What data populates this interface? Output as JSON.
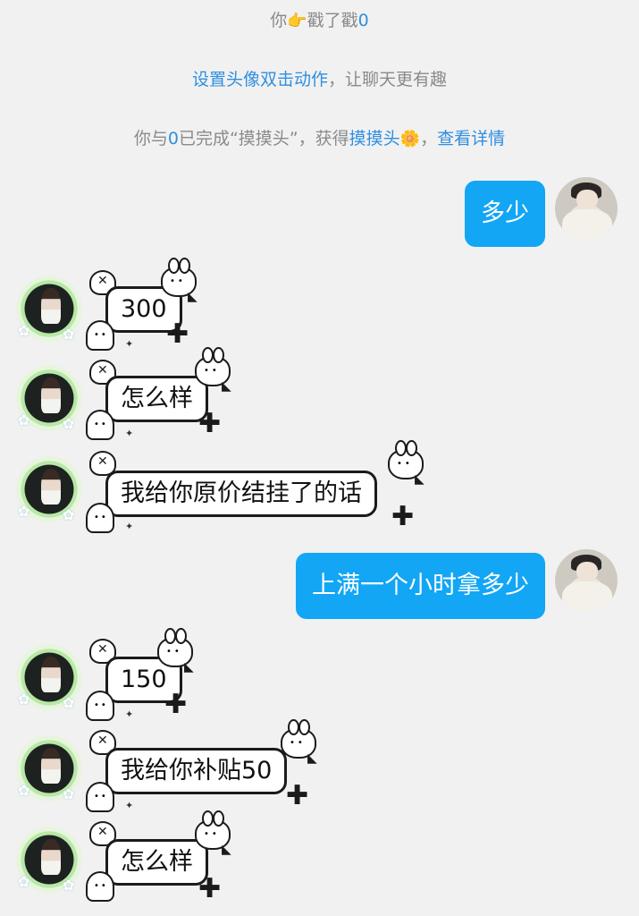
{
  "system_messages": {
    "poke": {
      "prefix": "你",
      "emoji": "👉",
      "middle": "戳了戳",
      "target": "0"
    },
    "avatar_hint": {
      "link": "设置头像双击动作",
      "rest": "，让聊天更有趣"
    },
    "achievement": {
      "prefix": "你与",
      "target": "0",
      "middle": "已完成“摸摸头”，获得",
      "badge": "摸摸头",
      "badge_emoji": "🌼",
      "sep": "，",
      "details_link": "查看详情"
    }
  },
  "messages": [
    {
      "side": "me",
      "text": "多少"
    },
    {
      "side": "her",
      "text": "300"
    },
    {
      "side": "her",
      "text": "怎么样"
    },
    {
      "side": "her",
      "text": "我给你原价结挂了的话"
    },
    {
      "side": "me",
      "text": "上满一个小时拿多少"
    },
    {
      "side": "her",
      "text": "150"
    },
    {
      "side": "her",
      "text": "我给你补贴50"
    },
    {
      "side": "her",
      "text": "怎么样"
    }
  ],
  "colors": {
    "background": "#f1f1f1",
    "sent_bubble": "#12a6f5",
    "link": "#2f8fe0",
    "system_text": "#8a8a8a"
  }
}
